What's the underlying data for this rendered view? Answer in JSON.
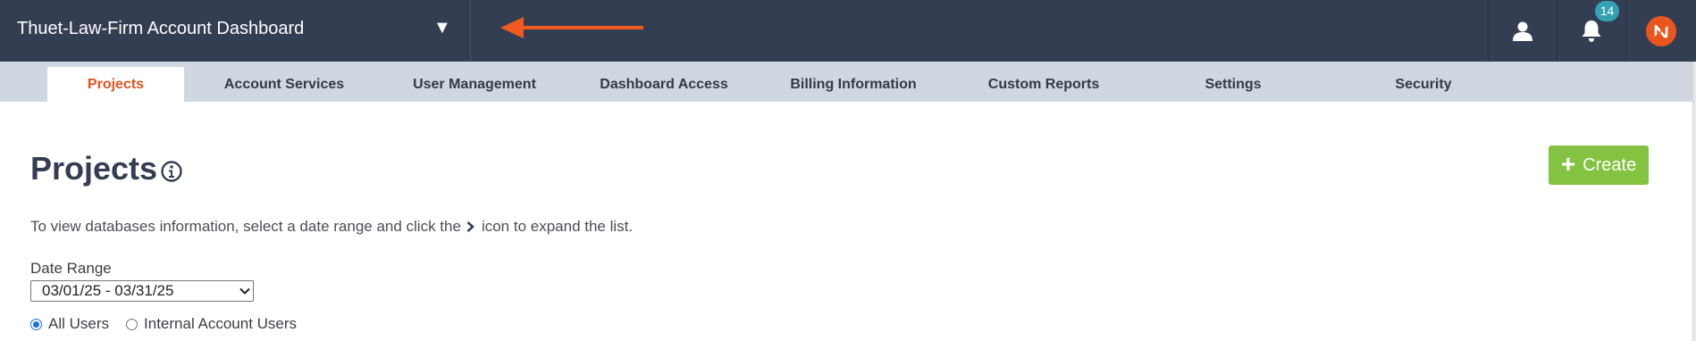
{
  "header": {
    "account_title": "Thuet-Law-Firm Account Dashboard",
    "caret": "▼",
    "notification_count": "14",
    "colors": {
      "bar": "#343e52",
      "badge": "#34a2b3",
      "brand": "#e8561e",
      "arrow": "#f05a1e"
    },
    "icons": [
      "dropdown-caret-icon",
      "annotation-arrow-icon",
      "user-icon",
      "bell-icon",
      "brand-logo-icon"
    ]
  },
  "tabs": [
    {
      "label": "Projects",
      "active": true
    },
    {
      "label": "Account Services"
    },
    {
      "label": "User Management"
    },
    {
      "label": "Dashboard Access"
    },
    {
      "label": "Billing Information"
    },
    {
      "label": "Custom Reports"
    },
    {
      "label": "Settings"
    },
    {
      "label": "Security"
    }
  ],
  "main": {
    "title": "Projects",
    "create_label": "Create",
    "instructions_before": "To view databases information, select a date range and click the",
    "instructions_after": "icon to expand the list.",
    "date_range_label": "Date Range",
    "date_range_value": "03/01/25 - 03/31/25",
    "radio_all": "All Users",
    "radio_internal": "Internal Account Users",
    "selected_radio": "All Users",
    "colors": {
      "active_tab": "#e2511f",
      "create_button": "#84c341",
      "title": "#343e52"
    }
  }
}
